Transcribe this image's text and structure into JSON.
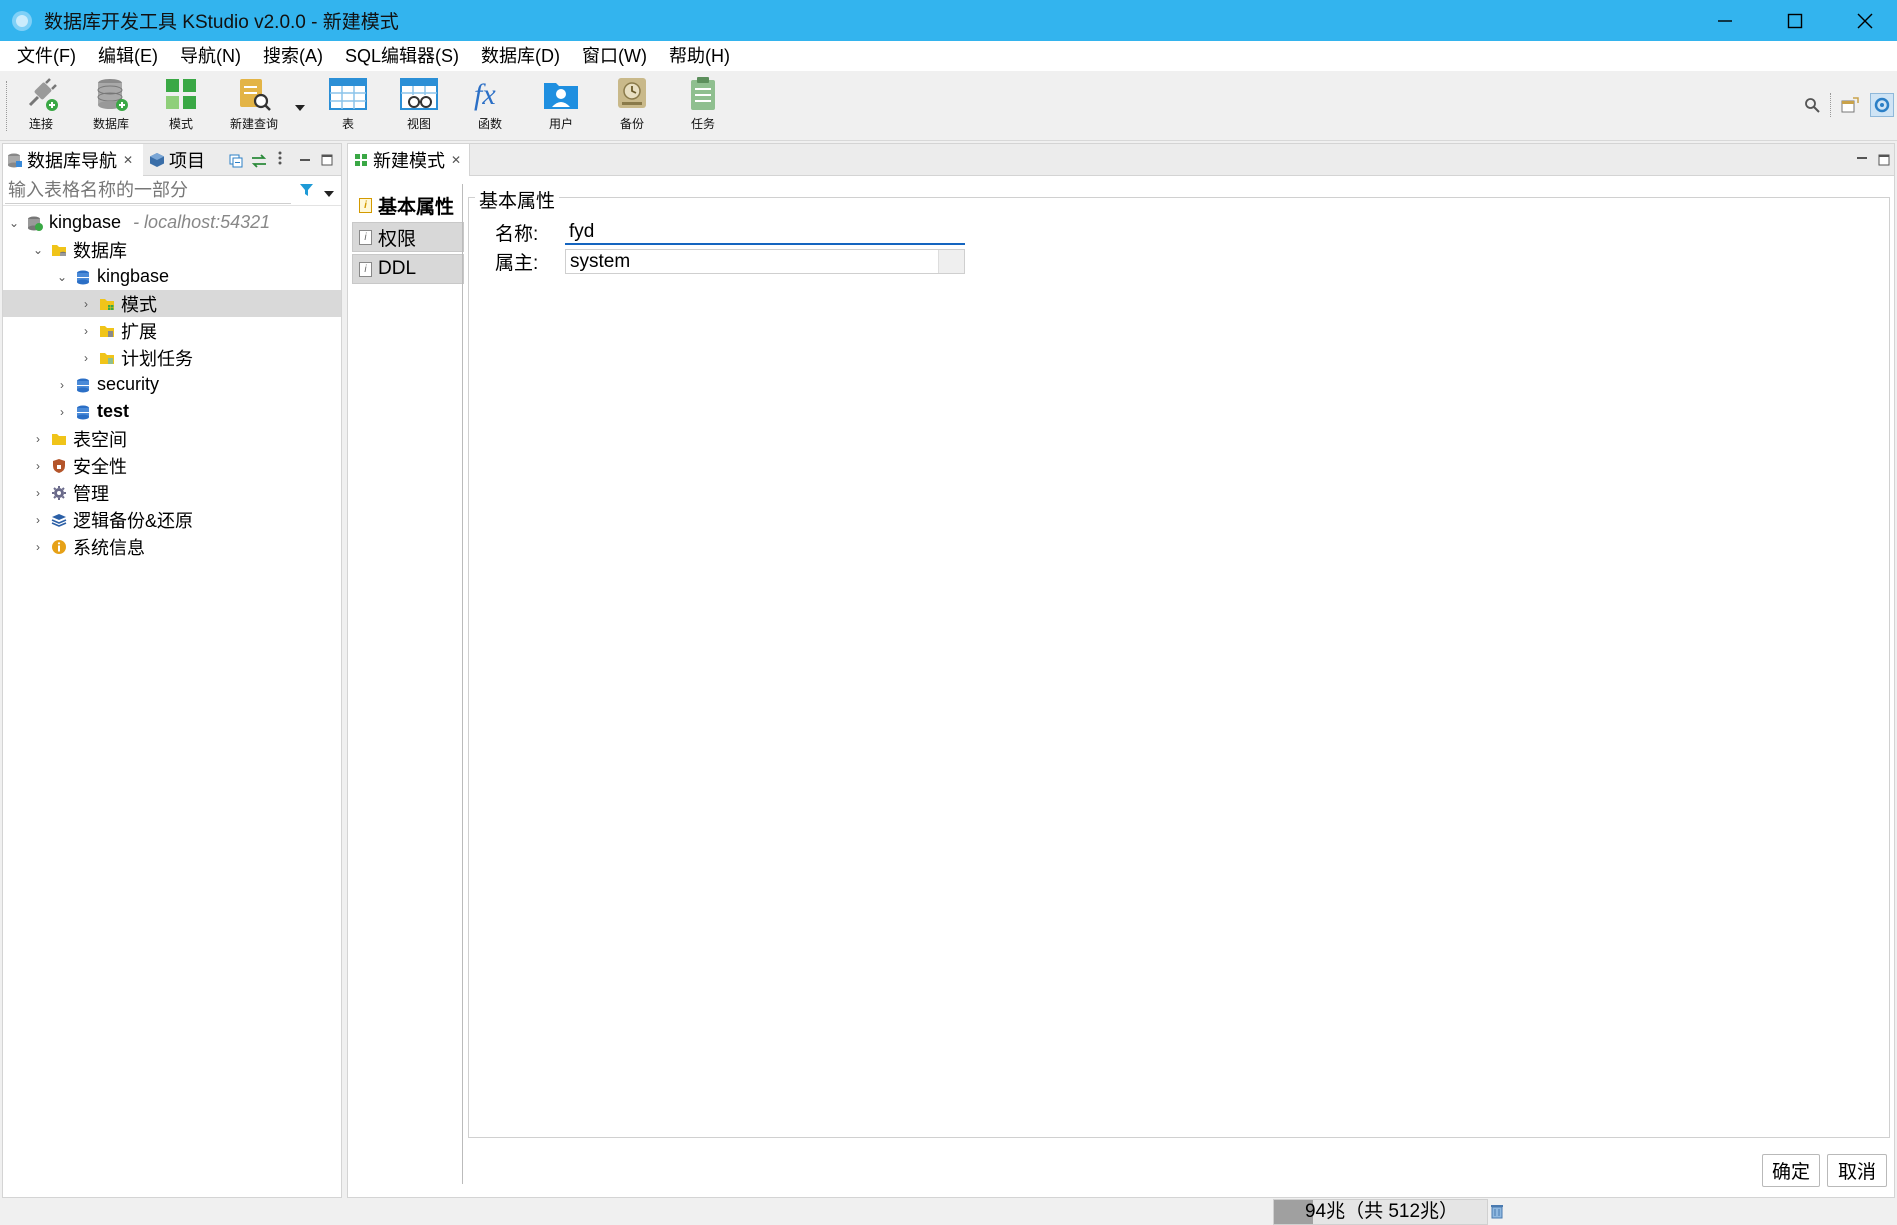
{
  "window": {
    "title": "数据库开发工具 KStudio v2.0.0 - 新建模式"
  },
  "menu": [
    "文件(F)",
    "编辑(E)",
    "导航(N)",
    "搜索(A)",
    "SQL编辑器(S)",
    "数据库(D)",
    "窗口(W)",
    "帮助(H)"
  ],
  "toolbar": {
    "connect": "连接",
    "database": "数据库",
    "schema": "模式",
    "new_query": "新建查询",
    "table": "表",
    "view": "视图",
    "function": "函数",
    "user": "用户",
    "backup": "备份",
    "task": "任务"
  },
  "navigator": {
    "tab_db_nav": "数据库导航",
    "tab_project": "项目",
    "filter_placeholder": "输入表格名称的一部分",
    "tree": {
      "conn": "kingbase",
      "conn_host": "- localhost:54321",
      "databases": "数据库",
      "db_kingbase": "kingbase",
      "schemas": "模式",
      "extensions": "扩展",
      "scheduled_tasks": "计划任务",
      "db_security": "security",
      "db_test": "test",
      "tablespaces": "表空间",
      "safety": "安全性",
      "management": "管理",
      "logical_backup": "逻辑备份&还原",
      "system_info": "系统信息"
    }
  },
  "editor": {
    "tab": "新建模式",
    "vtabs": [
      "基本属性",
      "权限",
      "DDL"
    ],
    "group_title": "基本属性",
    "name_label": "名称:",
    "name_value": "fyd",
    "owner_label": "属主:",
    "owner_value": "system",
    "ok": "确定",
    "cancel": "取消"
  },
  "status": {
    "memory": "94兆（共 512兆）",
    "memory_used_mb": 94,
    "memory_total_mb": 512
  },
  "colors": {
    "titlebar": "#33b4ee",
    "focus_underline": "#1565c0",
    "selection": "#d9d9d9"
  }
}
